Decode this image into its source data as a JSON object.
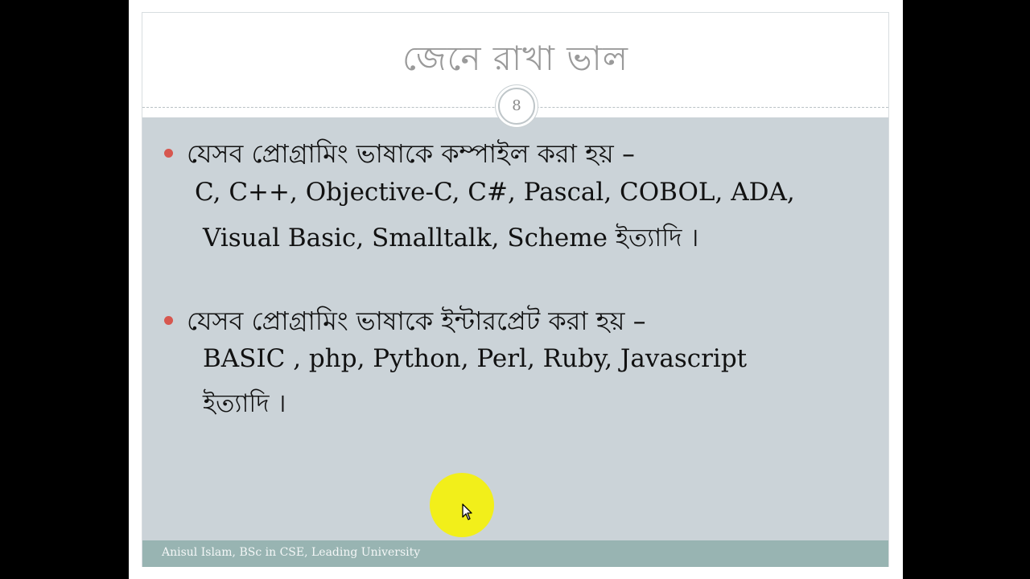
{
  "slide": {
    "title": "জেনে রাখা ভাল",
    "page_number": "8",
    "bullets": [
      {
        "heading": "যেসব প্রোগ্রামিং ভাষাকে কম্পাইল করা হয় –",
        "line1": "C, C++, Objective-C, C#, Pascal, COBOL, ADA,",
        "line2_en": "Visual Basic, Smalltalk, Scheme ",
        "line2_bn": "ইত্যাদি ।"
      },
      {
        "heading": "যেসব প্রোগ্রামিং ভাষাকে ইন্টারপ্রেট করা হয় –",
        "line1": "BASIC , php, Python, Perl, Ruby, Javascript",
        "line2_bn": "ইত্যাদি ।"
      }
    ],
    "footer": "Anisul Islam, BSc in CSE, Leading University"
  },
  "colors": {
    "background": "#000000",
    "slide_bg": "#ffffff",
    "content_bg": "#cbd3d8",
    "bullet_color": "#d7574f",
    "footer_bg": "#98b4b2",
    "title_color": "#9a9a9a",
    "cursor_highlight": "#f2ef1a"
  },
  "icons": {
    "bullet": "bullet-dot-icon",
    "cursor": "mouse-pointer-icon"
  }
}
